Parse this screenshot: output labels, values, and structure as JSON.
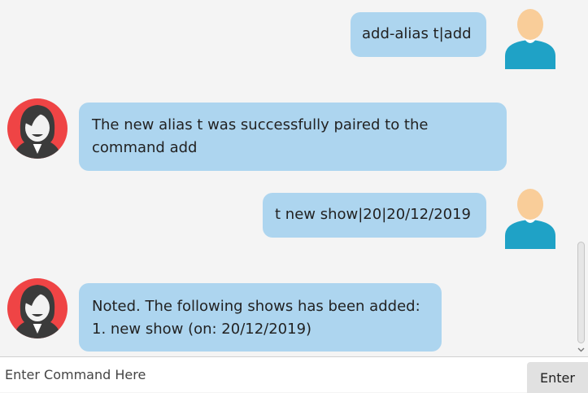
{
  "chat": {
    "messages": [
      {
        "sender": "user",
        "lines": [
          "add-alias t|add"
        ]
      },
      {
        "sender": "duke",
        "lines": [
          "The new alias t was successfully paired to the",
          "command add"
        ]
      },
      {
        "sender": "user",
        "lines": [
          "t new show|20|20/12/2019"
        ]
      },
      {
        "sender": "duke",
        "lines": [
          "Noted. The following shows has been added:",
          "1. new show (on: 20/12/2019)"
        ]
      }
    ]
  },
  "input": {
    "placeholder": "Enter Command Here",
    "value": ""
  },
  "enter_button": {
    "label": "Enter"
  },
  "colors": {
    "bubble": "#add5ef",
    "user_avatar_body": "#1fa2c6",
    "user_avatar_head": "#f9cd99",
    "bot_avatar_bg": "#ef4445",
    "bot_avatar_hair": "#3b3b3b"
  },
  "icons": {
    "user": "user-avatar-icon",
    "bot": "bot-avatar-icon",
    "scroll_down": "chevron-down-icon"
  }
}
